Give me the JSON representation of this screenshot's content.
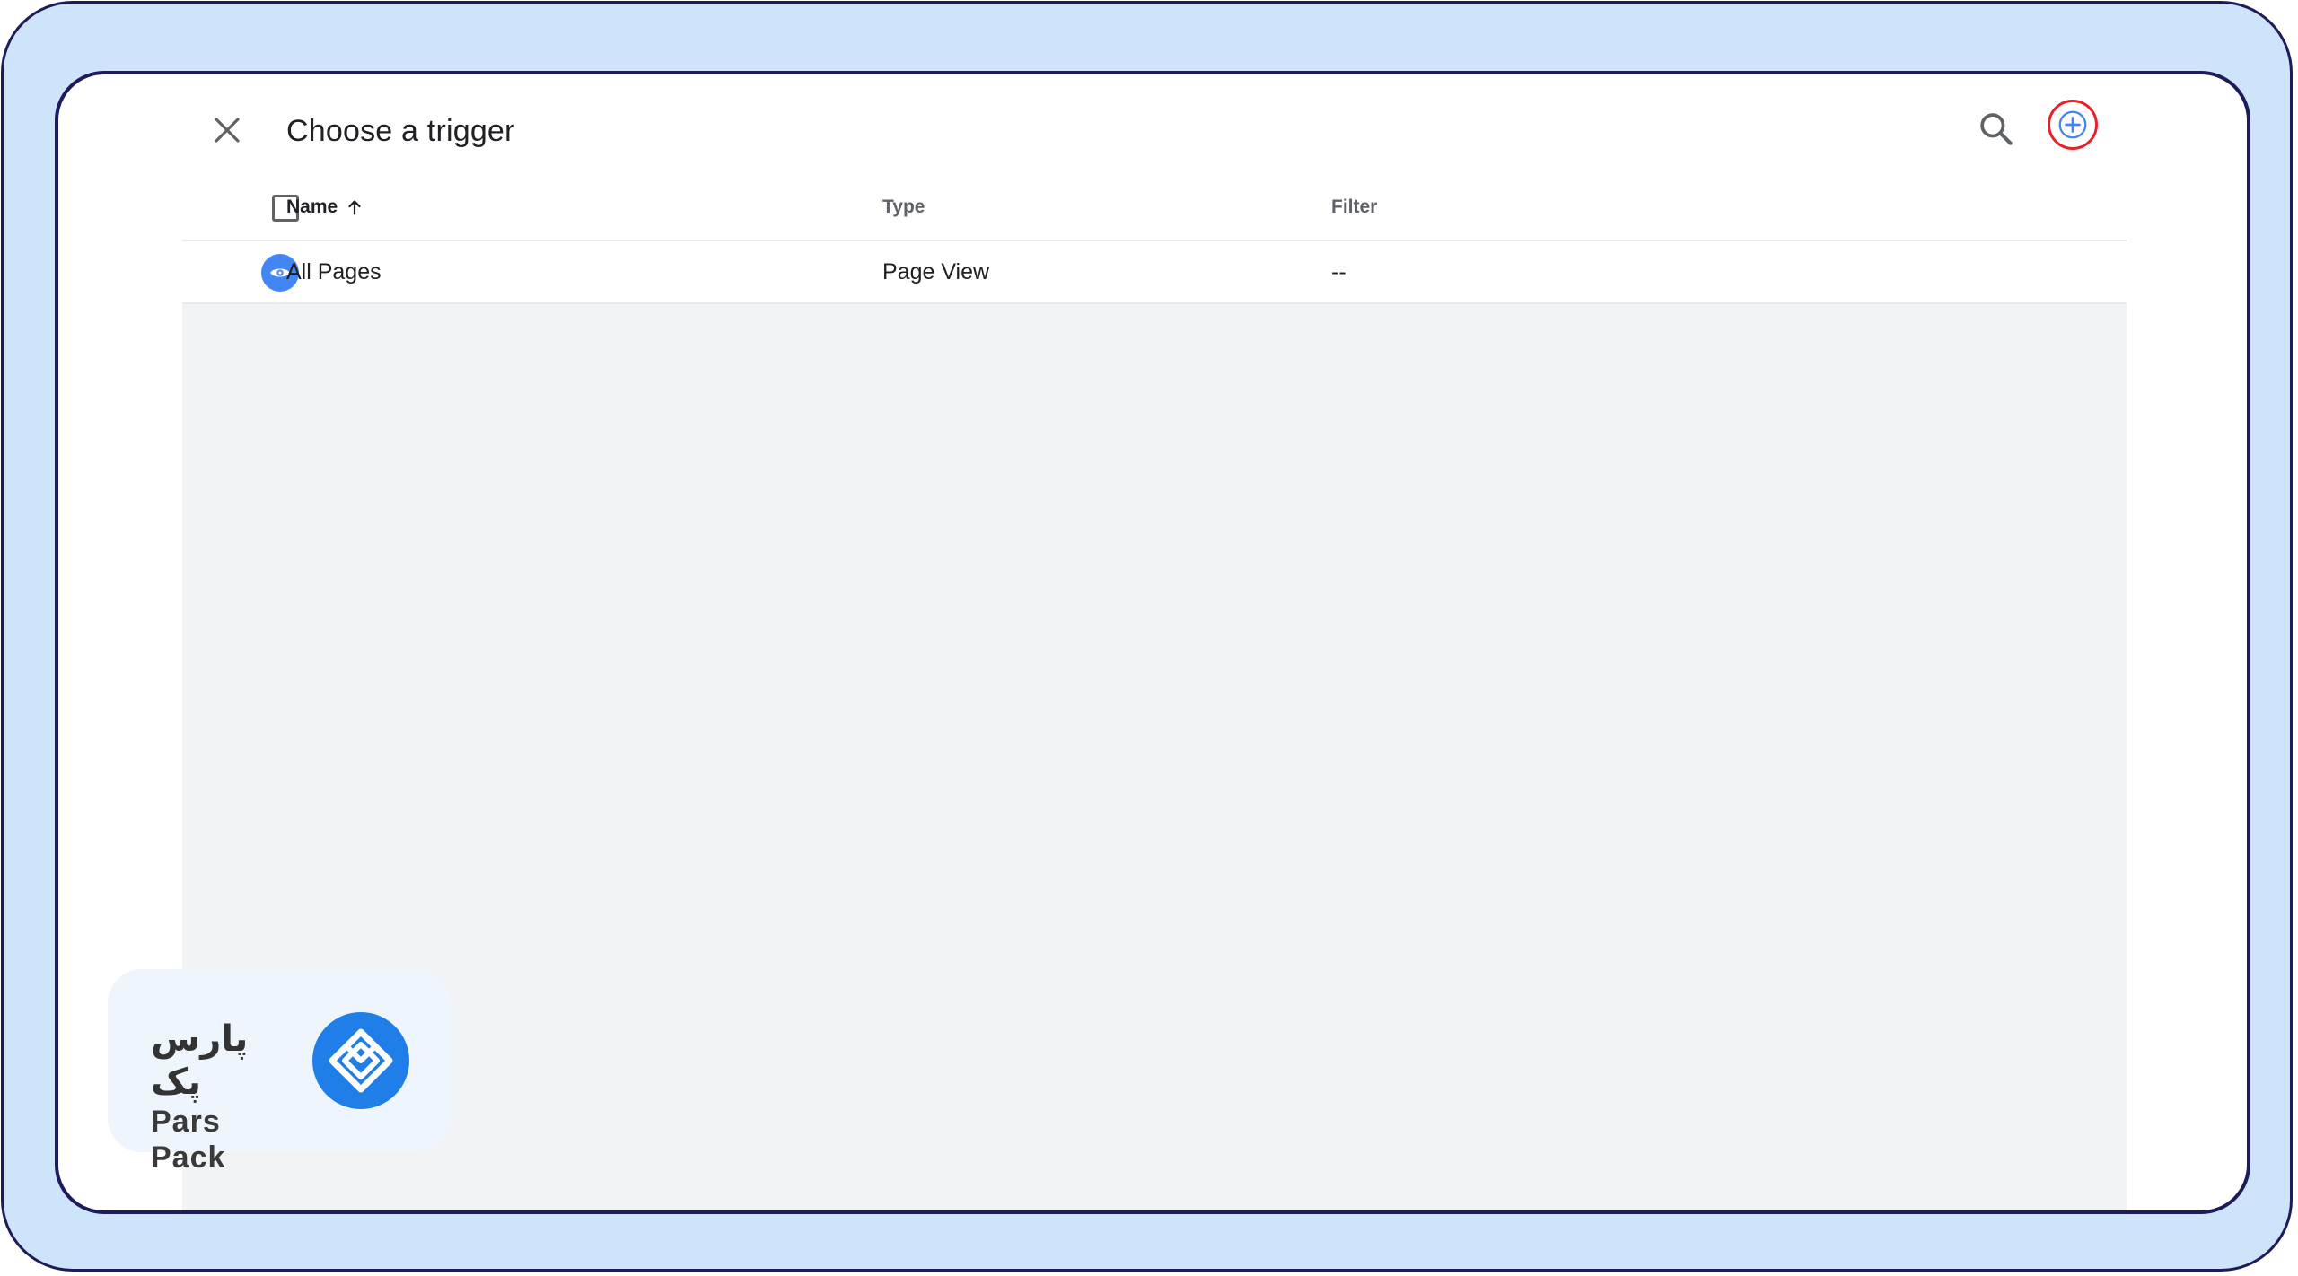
{
  "header": {
    "title": "Choose a trigger"
  },
  "icons": {
    "close": "close-icon",
    "search": "search-icon",
    "add": "add-circle-icon",
    "sort": "arrow-up-icon",
    "row": "eye-icon"
  },
  "table": {
    "columns": {
      "name": "Name",
      "type": "Type",
      "filter": "Filter"
    },
    "rows": [
      {
        "name": "All Pages",
        "type": "Page View",
        "filter": "--"
      }
    ]
  },
  "logo": {
    "persian": "پارس پک",
    "english": "Pars Pack"
  },
  "colors": {
    "accent": "#4285f4",
    "highlight": "#e8202a",
    "frame": "#cde4fb",
    "logo": "#1f7ee8"
  }
}
